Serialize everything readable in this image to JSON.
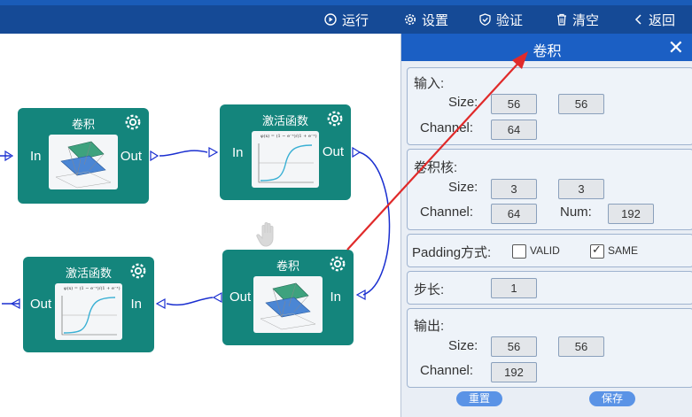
{
  "toolbar": {
    "run": "运行",
    "settings": "设置",
    "verify": "验证",
    "clear": "清空",
    "back": "返回"
  },
  "nodes": {
    "conv1": {
      "title": "卷积",
      "in": "In",
      "out": "Out"
    },
    "act1": {
      "title": "激活函数",
      "in": "In",
      "out": "Out",
      "formula": "φ(x) = (1 − e⁻ˣ)/(1 + e⁻ˣ)"
    },
    "conv2": {
      "title": "卷积",
      "in": "In",
      "out": "Out"
    },
    "act2": {
      "title": "激活函数",
      "in": "In",
      "out": "Out",
      "formula": "φ(x) = (1 − e⁻ˣ)/(1 + e⁻ˣ)"
    }
  },
  "panel": {
    "title": "卷积",
    "close": "✕",
    "input": {
      "header": "输入:",
      "size_label": "Size:",
      "size_w": "56",
      "size_h": "56",
      "channel_label": "Channel:",
      "channel": "64"
    },
    "kernel": {
      "header": "卷积核:",
      "size_label": "Size:",
      "size_w": "3",
      "size_h": "3",
      "channel_label": "Channel:",
      "channel": "64",
      "num_label": "Num:",
      "num": "192"
    },
    "padding": {
      "label": "Padding方式:",
      "valid": "VALID",
      "same": "SAME",
      "selected": "SAME"
    },
    "stride": {
      "label": "步长:",
      "value": "1"
    },
    "output": {
      "header": "输出:",
      "size_label": "Size:",
      "size_w": "56",
      "size_h": "56",
      "channel_label": "Channel:",
      "channel": "192"
    },
    "reset": "重置",
    "save": "保存"
  },
  "colors": {
    "toolbar": "#154a96",
    "node": "#14857c",
    "panel_header": "#1b5fc4",
    "arrow": "#e02a2a",
    "wire": "#1a2fd0"
  }
}
